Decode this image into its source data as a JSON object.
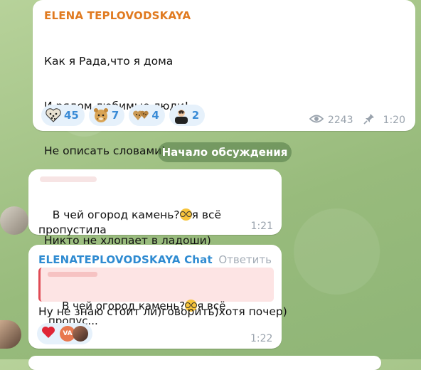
{
  "post": {
    "author": "ELENA TEPLOVODSKAYA",
    "author_color": "#e07a20",
    "lines": [
      "Как я Рада,что я дома",
      "И рядом любимые люди!",
      "Не описать словами)",
      "",
      "Никто не хлопает в ладоши)"
    ],
    "reactions": [
      {
        "icon": "leopard-heart-icon",
        "count": "45"
      },
      {
        "icon": "leopard-face-icon",
        "count": "7"
      },
      {
        "icon": "leopard-hearts-icon",
        "count": "4"
      },
      {
        "icon": "person-emoji-icon",
        "count": "2"
      }
    ],
    "views": "2243",
    "time": "1:20"
  },
  "divider": {
    "label": "Начало обсуждения"
  },
  "comment1": {
    "text_prefix": "В чей огород камень?",
    "text_suffix": "я всё пропустила",
    "time": "1:21"
  },
  "comment2": {
    "author": "ELENATEPLOVODSKAYA Chat",
    "author_color": "#2f8bd1",
    "reply_label": "Ответить",
    "quote_text_prefix": "В чей огород камень?",
    "quote_text_suffix": "я всё пропус...",
    "text": "Ну не знаю стоит ли)говорить)хотя почер)",
    "reactions": [
      {
        "icon": "red-heart-icon"
      },
      {
        "icon": "avatar-va-icon",
        "label": "VA"
      }
    ],
    "time": "1:22"
  },
  "colors": {
    "accent_blue": "#3a8bd6",
    "reaction_bg": "#e6f1fb",
    "quote_bg": "#fde4e4",
    "quote_bar": "#e04b55"
  }
}
